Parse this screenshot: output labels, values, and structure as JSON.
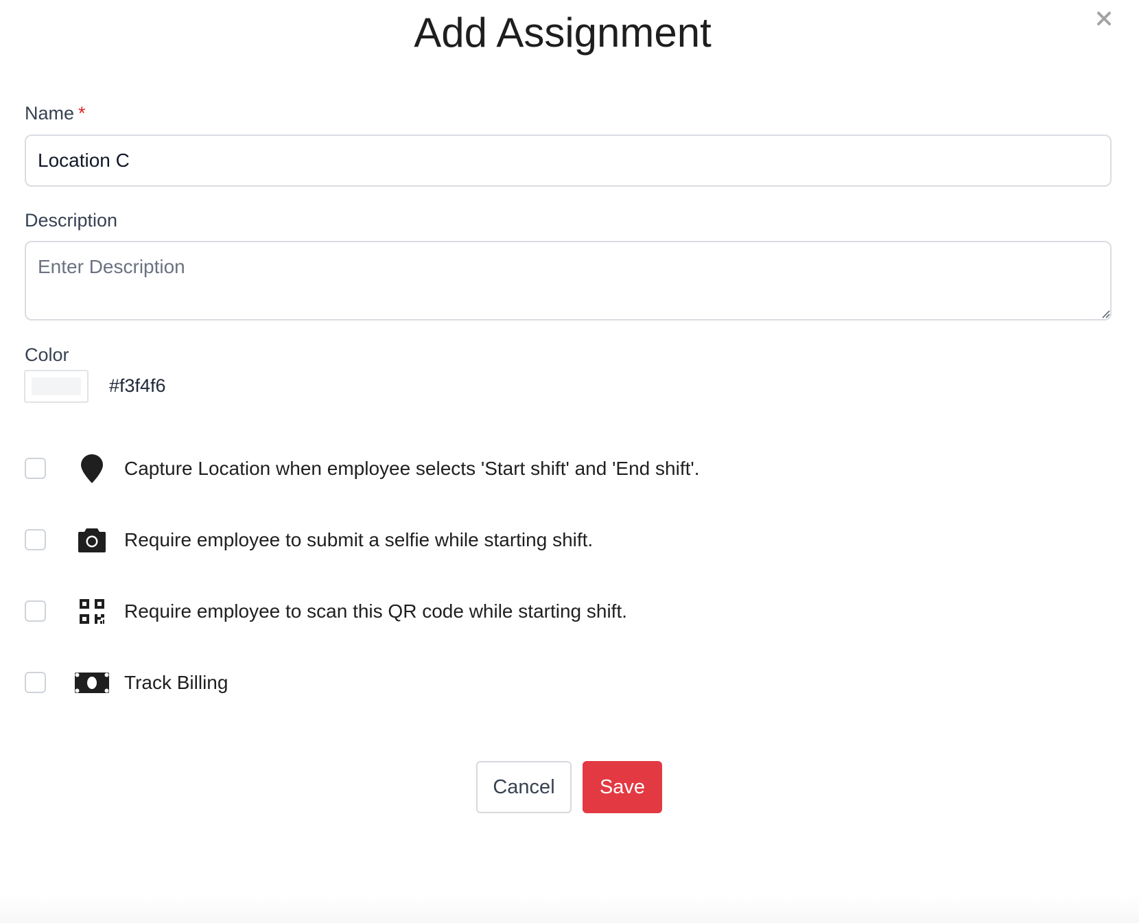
{
  "dialog": {
    "title": "Add Assignment",
    "close_icon": "close-icon"
  },
  "form": {
    "name": {
      "label": "Name",
      "required_marker": "*",
      "value": "Location C"
    },
    "description": {
      "label": "Description",
      "placeholder": "Enter Description",
      "value": ""
    },
    "color": {
      "label": "Color",
      "value": "#f3f4f6"
    },
    "options": [
      {
        "icon": "map-pin-icon",
        "text": "Capture Location when employee selects 'Start shift' and 'End shift'.",
        "checked": false
      },
      {
        "icon": "camera-icon",
        "text": "Require employee to submit a selfie while starting shift.",
        "checked": false
      },
      {
        "icon": "qr-code-icon",
        "text": "Require employee to scan this QR code while starting shift.",
        "checked": false
      },
      {
        "icon": "money-bill-icon",
        "text": "Track Billing",
        "checked": false
      }
    ]
  },
  "actions": {
    "cancel_label": "Cancel",
    "save_label": "Save"
  },
  "colors": {
    "accent": "#e33942",
    "icon": "#1f1f1f",
    "border": "#d9dce1"
  }
}
